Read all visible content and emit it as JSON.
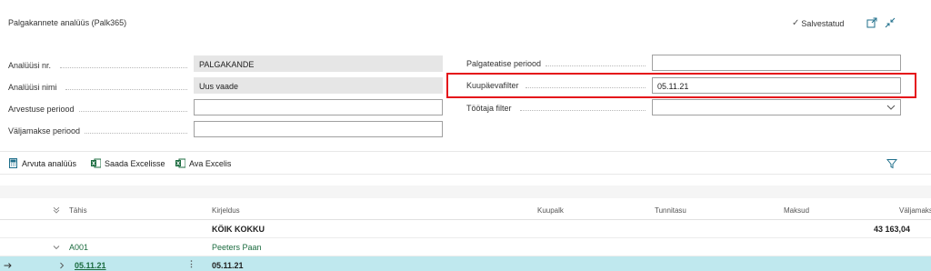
{
  "header": {
    "title": "Palgakannete analüüs (Palk365)",
    "saved_status": "Salvestatud"
  },
  "form": {
    "left": [
      {
        "label": "Analüüsi nr.",
        "value": "PALGAKANDE"
      },
      {
        "label": "Analüüsi nimi",
        "value": "Uus vaade"
      },
      {
        "label": "Arvestuse periood",
        "value": ""
      },
      {
        "label": "Väljamakse periood",
        "value": ""
      }
    ],
    "right": [
      {
        "label": "Palgateatise periood",
        "value": ""
      },
      {
        "label": "Kuupäevafilter",
        "value": "05.11.21"
      },
      {
        "label": "Töötaja filter",
        "value": ""
      }
    ]
  },
  "actions": {
    "calculate": "Arvuta analüüs",
    "send_excel": "Saada Excelisse",
    "open_excel": "Ava Excelis"
  },
  "grid": {
    "columns": {
      "tahis": "Tähis",
      "kirjeldus": "Kirjeldus",
      "kuupalk": "Kuupalk",
      "tunnitasu": "Tunnitasu",
      "maksud": "Maksud",
      "valjamaks": "Väljamaks"
    },
    "total": {
      "kirjeldus": "KÖIK KOKKU",
      "valjamaks": "43 163,04"
    },
    "group": {
      "tahis": "A001",
      "kirjeldus": "Peeters Paan"
    },
    "selected": {
      "tahis": "05.11.21",
      "kirjeldus": "05.11.21"
    }
  },
  "colors": {
    "accent": "#1f6f8b",
    "selection": "#bfe8ee",
    "highlight": "#e5131a",
    "link": "#1b6b3f"
  },
  "icons": [
    "check-icon",
    "share-icon",
    "collapse-icon",
    "chevron-down-icon",
    "calculator-icon",
    "excel-icon",
    "filter-icon",
    "arrow-right-icon",
    "chevron-right-icon"
  ]
}
